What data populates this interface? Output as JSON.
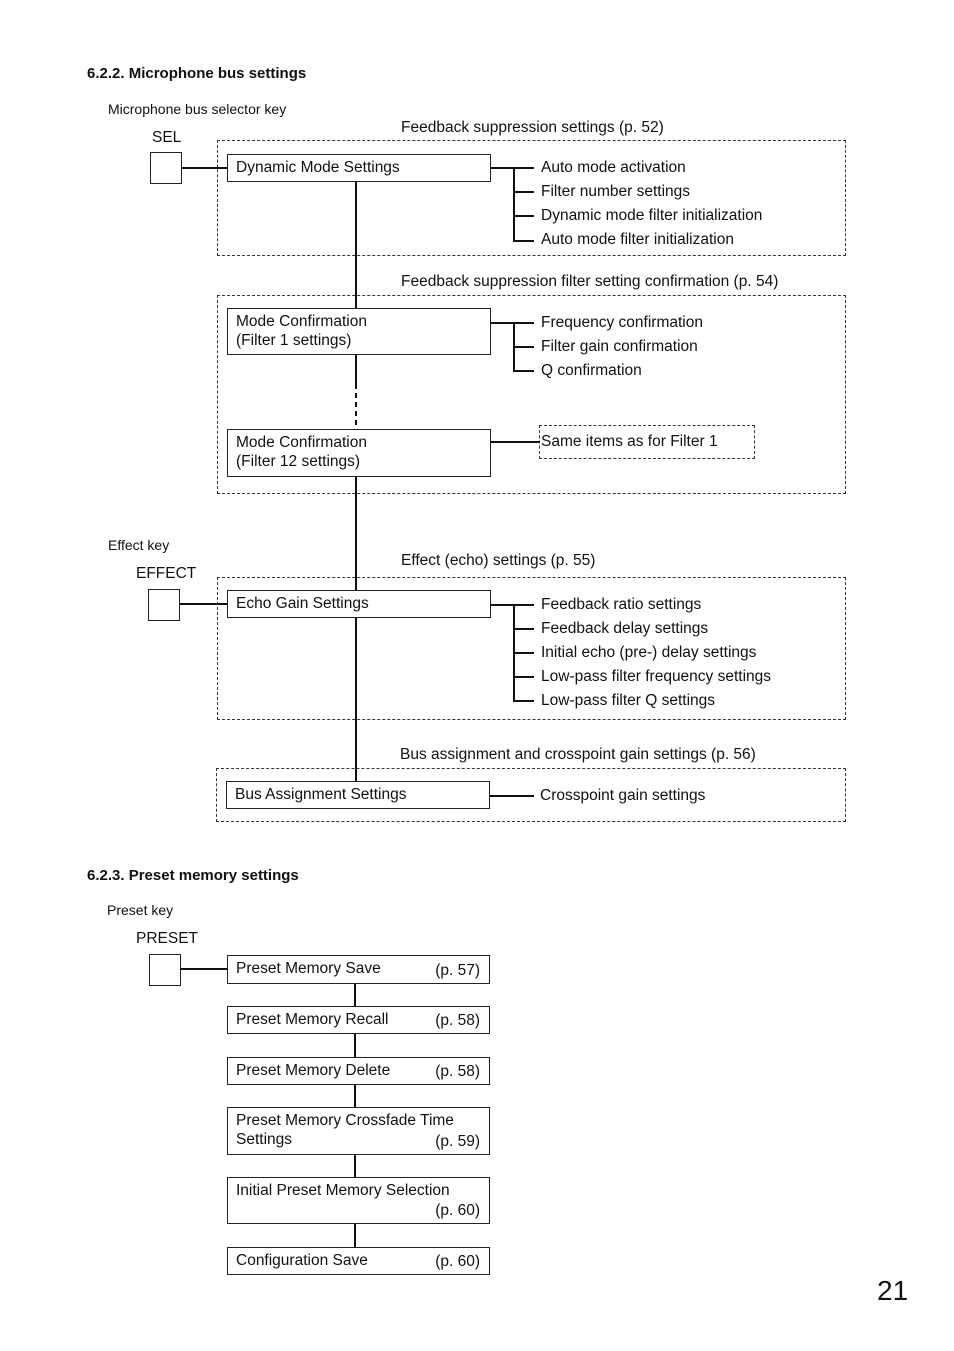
{
  "section_622": {
    "title": "6.2.2. Microphone bus settings",
    "sel_caption": "Microphone bus selector key",
    "sel_key": "SEL",
    "effect_caption": "Effect key",
    "effect_key": "EFFECT",
    "groups": [
      {
        "title": "Feedback suppression settings (p. 52)",
        "box": "Dynamic Mode Settings",
        "items": [
          "Auto mode activation",
          "Filter number settings",
          "Dynamic mode filter initialization",
          "Auto mode filter initialization"
        ]
      },
      {
        "title": "Feedback suppression filter setting confirmation (p. 54)",
        "box1_line1": "Mode Confirmation",
        "box1_line2": "(Filter 1 settings)",
        "items": [
          "Frequency confirmation",
          "Filter gain confirmation",
          "Q confirmation"
        ],
        "box12_line1": "Mode Confirmation",
        "box12_line2": "(Filter 12 settings)",
        "same_items": "Same items as for Filter 1"
      },
      {
        "title": "Effect (echo) settings (p. 55)",
        "box": "Echo Gain Settings",
        "items": [
          "Feedback ratio settings",
          "Feedback delay settings",
          "Initial echo (pre-) delay settings",
          "Low-pass filter frequency settings",
          "Low-pass filter Q settings"
        ]
      },
      {
        "title": "Bus assignment and crosspoint gain settings (p. 56)",
        "box": "Bus Assignment Settings",
        "items": [
          "Crosspoint gain settings"
        ]
      }
    ]
  },
  "section_623": {
    "title": "6.2.3. Preset memory settings",
    "caption": "Preset key",
    "key": "PRESET",
    "boxes": [
      {
        "line1": "Preset Memory Save",
        "line2": "",
        "page": "(p. 57)"
      },
      {
        "line1": "Preset Memory Recall",
        "line2": "",
        "page": "(p. 58)"
      },
      {
        "line1": "Preset Memory Delete",
        "line2": "",
        "page": "(p. 58)"
      },
      {
        "line1": "Preset Memory Crossfade Time",
        "line2": "Settings",
        "page": "(p. 59)"
      },
      {
        "line1": "Initial Preset Memory Selection",
        "line2": "",
        "page": "(p. 60)"
      },
      {
        "line1": "Configuration Save",
        "line2": "",
        "page": "(p. 60)"
      }
    ]
  },
  "page_number": "21"
}
